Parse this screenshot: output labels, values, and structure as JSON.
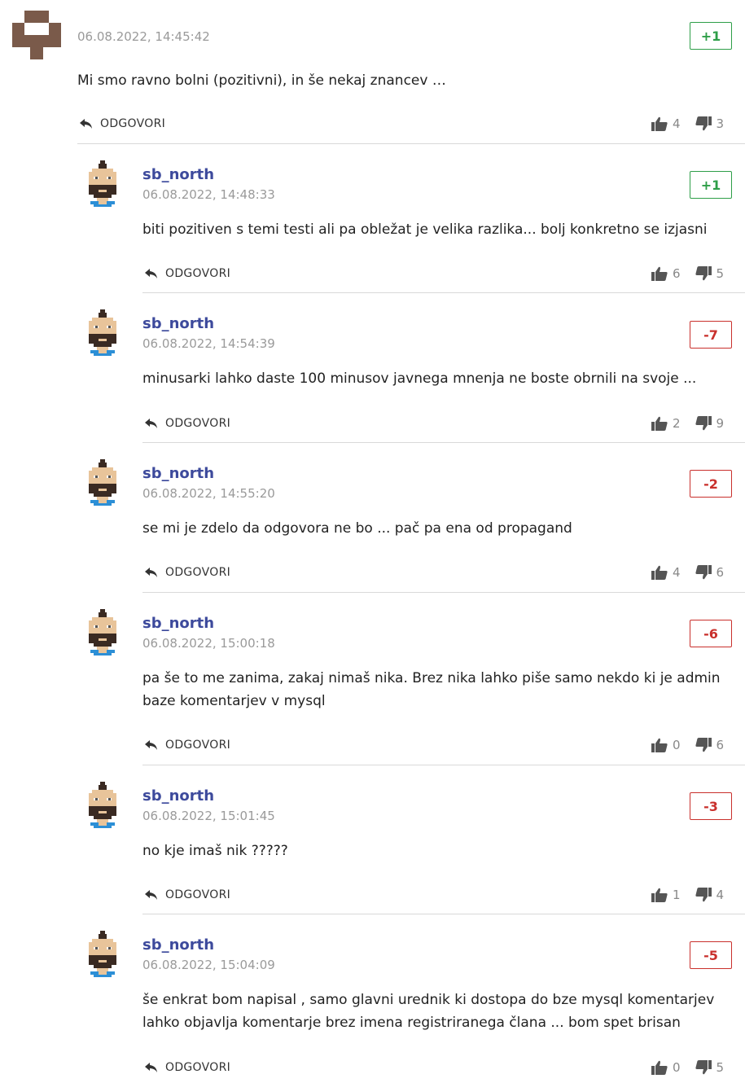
{
  "comments": [
    {
      "author": "",
      "date": "06.08.2022, 14:45:42",
      "score": "+1",
      "scoreType": "pos",
      "text": "Mi smo ravno bolni (pozitivni), in še nekaj znancev …",
      "reply": "ODGOVORI",
      "up": "4",
      "down": "3",
      "avatar": "pattern-avatar-icon"
    },
    {
      "author": "sb_north",
      "date": "06.08.2022, 14:48:33",
      "score": "+1",
      "scoreType": "pos",
      "text": "biti pozitiven s temi testi ali pa obležat je velika razlika... bolj konkretno se izjasni",
      "reply": "ODGOVORI",
      "up": "6",
      "down": "5",
      "avatar": "bearded-man-avatar-icon"
    },
    {
      "author": "sb_north",
      "date": "06.08.2022, 14:54:39",
      "score": "-7",
      "scoreType": "neg",
      "text": "minusarki lahko daste 100 minusov javnega mnenja ne boste obrnili na svoje ...",
      "reply": "ODGOVORI",
      "up": "2",
      "down": "9",
      "avatar": "bearded-man-avatar-icon"
    },
    {
      "author": "sb_north",
      "date": "06.08.2022, 14:55:20",
      "score": "-2",
      "scoreType": "neg",
      "text": "se mi je zdelo da odgovora ne bo ... pač pa ena od propagand",
      "reply": "ODGOVORI",
      "up": "4",
      "down": "6",
      "avatar": "bearded-man-avatar-icon"
    },
    {
      "author": "sb_north",
      "date": "06.08.2022, 15:00:18",
      "score": "-6",
      "scoreType": "neg",
      "text1": "pa še to me zanima, zakaj nimaš nika. Brez nika lahko piše samo nekdo ki je admin",
      "text2": "baze komentarjev v mysql",
      "reply": "ODGOVORI",
      "up": "0",
      "down": "6",
      "avatar": "bearded-man-avatar-icon"
    },
    {
      "author": "sb_north",
      "date": "06.08.2022, 15:01:45",
      "score": "-3",
      "scoreType": "neg",
      "text": "no kje imaš nik ?????",
      "reply": "ODGOVORI",
      "up": "1",
      "down": "4",
      "avatar": "bearded-man-avatar-icon"
    },
    {
      "author": "sb_north",
      "date": "06.08.2022, 15:04:09",
      "score": "-5",
      "scoreType": "neg",
      "text1": "še enkrat bom napisal , samo glavni urednik ki dostopa do bze mysql komentarjev",
      "text2": "lahko objavlja komentarje brez imena registriranega člana ... bom spet brisan",
      "reply": "ODGOVORI",
      "up": "0",
      "down": "5",
      "avatar": "bearded-man-avatar-icon"
    }
  ],
  "colors": {
    "positive": "#2e9e48",
    "negative": "#c9302c",
    "author": "#3d4a9c",
    "divider": "#d9d9d9"
  }
}
